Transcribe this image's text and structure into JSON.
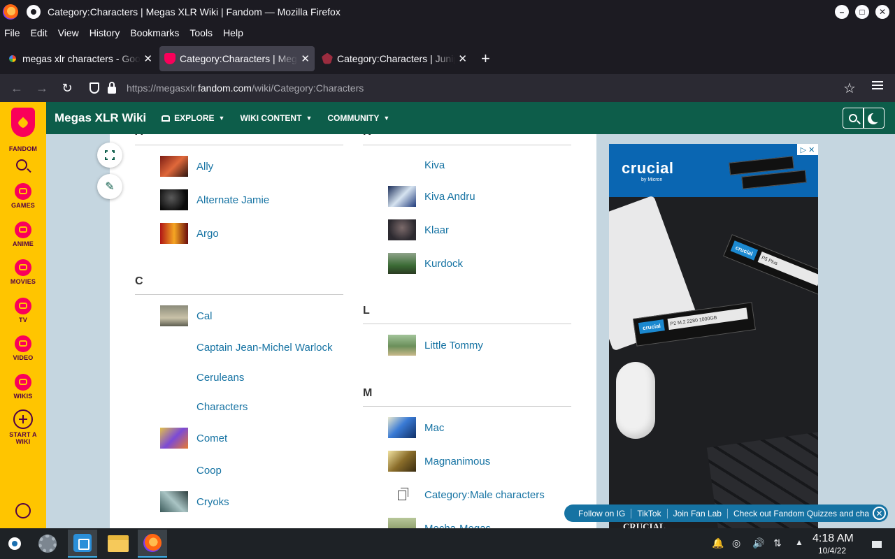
{
  "window": {
    "title": "Category:Characters | Megas XLR Wiki | Fandom — Mozilla Firefox",
    "minimize": "–",
    "maximize": "□",
    "close": "✕"
  },
  "menu": [
    "File",
    "Edit",
    "View",
    "History",
    "Bookmarks",
    "Tools",
    "Help"
  ],
  "tabs": [
    {
      "label": "megas xlr characters - Google Search",
      "favicon": "google-icon",
      "active": false
    },
    {
      "label": "Category:Characters | Megas XLR Wiki",
      "favicon": "fandom-icon",
      "active": true
    },
    {
      "label": "Category:Characters | Juniper",
      "favicon": "juniper-icon",
      "active": false
    }
  ],
  "tab_close": "✕",
  "new_tab": "+",
  "nav": {
    "back": "←",
    "forward": "→",
    "reload": "↻",
    "url_prefix": "https://megasxlr.",
    "url_domain": "fandom.com",
    "url_path": "/wiki/Category:Characters",
    "bookmark_star": "☆"
  },
  "rail": {
    "fandom": "FANDOM",
    "items": [
      "GAMES",
      "ANIME",
      "MOVIES",
      "TV",
      "VIDEO",
      "WIKIS"
    ],
    "start_line1": "START A",
    "start_line2": "WIKI"
  },
  "wiki": {
    "name": "Megas XLR Wiki",
    "explore": "EXPLORE",
    "content": "WIKI CONTENT",
    "community": "COMMUNITY",
    "caret": "▼"
  },
  "page": {
    "fullscreen_btn": "",
    "edit_btn": "✎",
    "left_column": {
      "sections": [
        {
          "letter": "A",
          "entries": [
            "Ally",
            "Alternate Jamie",
            "Argo"
          ]
        },
        {
          "letter": "C",
          "entries": [
            "Cal",
            "Captain Jean-Michel Warlock",
            "Ceruleans",
            "Characters",
            "Comet",
            "Coop",
            "Cryoks"
          ]
        }
      ]
    },
    "right_column": {
      "sections": [
        {
          "letter": "K",
          "entries": [
            "Kiva",
            "Kiva Andru",
            "Klaar",
            "Kurdock"
          ]
        },
        {
          "letter": "L",
          "entries": [
            "Little Tommy"
          ]
        },
        {
          "letter": "M",
          "entries": [
            "Mac",
            "Magnanimous",
            "Category:Male characters",
            "Mecha-Megas"
          ]
        }
      ]
    }
  },
  "ad": {
    "logo": "crucial",
    "micron": "by Micron",
    "ssd_label": "crucial",
    "ssd_spec": "P2 M.2 2280  1000GB",
    "ssd2_spec": "P5 Plus",
    "bottom_brand": "CRUCIAL",
    "choices": "▷ ✕"
  },
  "social": {
    "items": [
      "Follow on IG",
      "TikTok",
      "Join Fan Lab",
      "Check out Fandom Quizzes and cha"
    ],
    "close": "✕"
  },
  "taskbar": {
    "time": "4:18 AM",
    "date": "10/4/22"
  },
  "colors": {
    "fandom_yellow": "#ffc500",
    "wiki_green": "#0d5d4a",
    "link_blue": "#1673a3",
    "firefox_dark": "#1c1b22"
  }
}
